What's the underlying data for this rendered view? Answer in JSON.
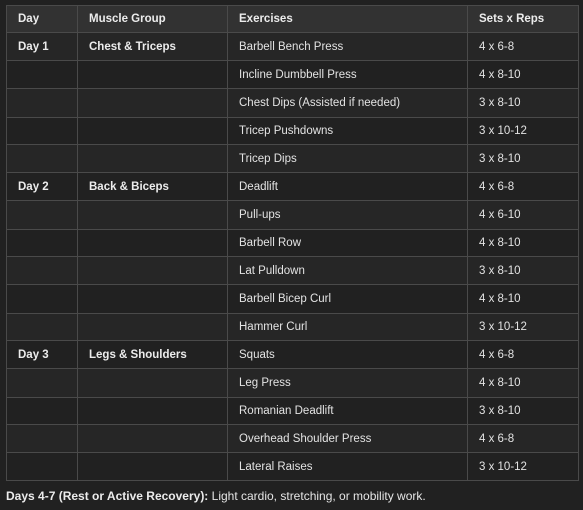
{
  "headers": {
    "day": "Day",
    "muscle_group": "Muscle Group",
    "exercises": "Exercises",
    "sets_reps": "Sets x Reps"
  },
  "rows": [
    {
      "day": "Day 1",
      "muscle": "Chest & Triceps",
      "exercise": "Barbell Bench Press",
      "sets": "4 x 6-8"
    },
    {
      "day": "",
      "muscle": "",
      "exercise": "Incline Dumbbell Press",
      "sets": "4 x 8-10"
    },
    {
      "day": "",
      "muscle": "",
      "exercise": "Chest Dips (Assisted if needed)",
      "sets": "3 x 8-10"
    },
    {
      "day": "",
      "muscle": "",
      "exercise": "Tricep Pushdowns",
      "sets": "3 x 10-12"
    },
    {
      "day": "",
      "muscle": "",
      "exercise": "Tricep Dips",
      "sets": "3 x 8-10"
    },
    {
      "day": "Day 2",
      "muscle": "Back & Biceps",
      "exercise": "Deadlift",
      "sets": "4 x 6-8"
    },
    {
      "day": "",
      "muscle": "",
      "exercise": "Pull-ups",
      "sets": "4 x 6-10"
    },
    {
      "day": "",
      "muscle": "",
      "exercise": "Barbell Row",
      "sets": "4 x 8-10"
    },
    {
      "day": "",
      "muscle": "",
      "exercise": "Lat Pulldown",
      "sets": "3 x 8-10"
    },
    {
      "day": "",
      "muscle": "",
      "exercise": "Barbell Bicep Curl",
      "sets": "4 x 8-10"
    },
    {
      "day": "",
      "muscle": "",
      "exercise": "Hammer Curl",
      "sets": "3 x 10-12"
    },
    {
      "day": "Day 3",
      "muscle": "Legs & Shoulders",
      "exercise": "Squats",
      "sets": "4 x 6-8"
    },
    {
      "day": "",
      "muscle": "",
      "exercise": "Leg Press",
      "sets": "4 x 8-10"
    },
    {
      "day": "",
      "muscle": "",
      "exercise": "Romanian Deadlift",
      "sets": "3 x 8-10"
    },
    {
      "day": "",
      "muscle": "",
      "exercise": "Overhead Shoulder Press",
      "sets": "4 x 6-8"
    },
    {
      "day": "",
      "muscle": "",
      "exercise": "Lateral Raises",
      "sets": "3 x 10-12"
    }
  ],
  "note": {
    "label": "Days 4-7 (Rest or Active Recovery):",
    "text": " Light cardio, stretching, or mobility work."
  }
}
